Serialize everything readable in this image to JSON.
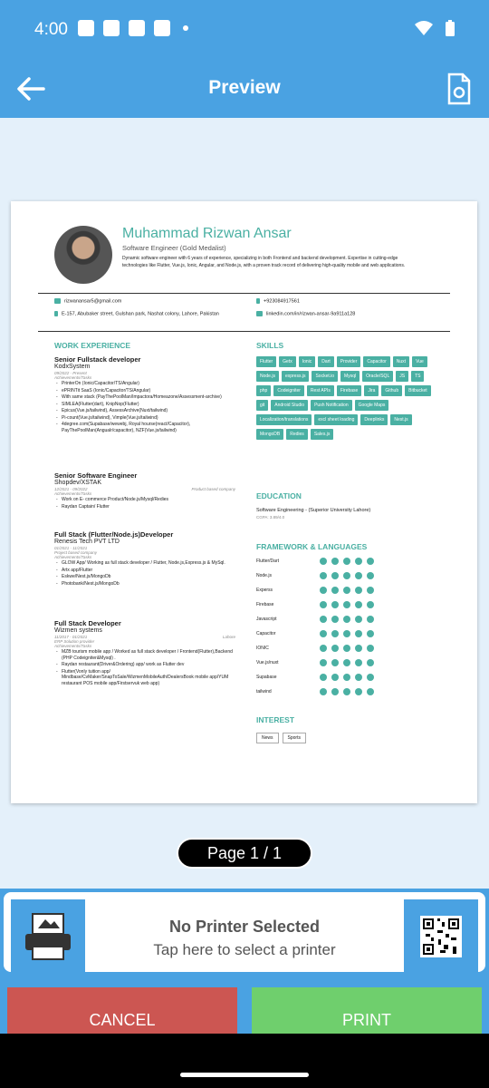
{
  "status": {
    "time": "4:00"
  },
  "appbar": {
    "title": "Preview"
  },
  "resume": {
    "name": "Muhammad Rizwan Ansar",
    "title": "Software Engineer (Gold Medalist)",
    "summary": "Dynamic software engineer with 6 years of experience, specializing in both Frontend and backend development. Expertise in cutting-edge technologies like Flutter, Vue.js, Ionic, Angular, and Node.js, with a proven track record of delivering high-quality mobile and web applications.",
    "email": "rizwanansar5@gmail.com",
    "address": "E-157, Abubaker street, Gulshan park, Nashat colony, Lahore, Pakistan",
    "phone": "+923084917561",
    "linkedin": "linkedin.com/in/rizwan-ansar-9a911a128",
    "sections": {
      "work": "WORK EXPERIENCE",
      "skills": "SKILLS",
      "education": "EDUCATION",
      "framework": "FRAMEWORK & LANGUAGES",
      "interest": "INTEREST"
    },
    "jobs": [
      {
        "title": "Senior Fullstack developer",
        "company": "KodxSystem",
        "date": "09/2022 - Present",
        "loc": "",
        "sub": "Achievements/Tasks",
        "items": [
          "PrinterOn (Ionic/Capacitor/TS/Angular)",
          "ePRINTit SaaS (Ionic/Capacitor/TS/Angular)",
          "With same stack (PayThePoolMan/Impactora/Homeazone/Assessment-archive)",
          "SIMLEA(Flutter(dart), KnipNop(Flutter)",
          "Epicus(Vue.js/tailwind), AssessArchive(Nuxt/tailwind)",
          "Pi-count(Vue.js/tailwind), Vimple(Vue.js/tailwind)",
          "4degree.com(Supabase/wewebj, Royal hourse(react/Capacitor), PayThePoolMan(Angualr/capacitor), NZF(Vue.js/tailwind)"
        ]
      },
      {
        "title": "Senior Software Engineer",
        "company": "Shopdev/XSTAK",
        "date": "12/2021 - 09/2022",
        "loc": "Product based company",
        "sub": "Achievements/Tasks",
        "items": [
          "Work on E- commerce Product/Node.js/Mysql/Redies",
          "Raydan Captain/ Flutter"
        ]
      },
      {
        "title": "Full Stack (Flutter/Node.js)Developer",
        "company": "Renesis Tech PVT LTD",
        "date": "01/2021 - 11/2021",
        "loc": "",
        "sub": "Project based company",
        "sub2": "Achievements/Tasks",
        "items": [
          "GLOW App/ Working as full stack developer / Flutter, Node.js,Express.js & MySql.",
          "Artx app/Flutter",
          "Eskwe/Nest.js/MongoDb",
          "Photobank/Nest.js/MongoDb"
        ]
      },
      {
        "title": "Full Stack Developer",
        "company": "Wizmen systems",
        "date": "11/2017 - 01/2021",
        "loc": "Lahore",
        "sub": "ERP Solution provider",
        "sub2": "Achievements/Tasks",
        "items": [
          "MZB tourism mobile app / Worked as full stack developer / Frontend(Flutter),Backend (PHP Codeigniter&Mysql) .",
          "Raydan restaurant(Driver&Ordering) app/ work as Flutter dev",
          "Flutter(Vonly tuition app/ Mindbase/CvMaker/SnapToSale/WizmenMobileAuth/DealersBook mobile app/YUM restaurant POS mobile app/Firstservuk web app)"
        ]
      }
    ],
    "skills": [
      "Flutter",
      "Getx",
      "Ionic",
      "Dart",
      "Provider",
      "Capacitor",
      "Nuxt",
      "Vue",
      "Node.js",
      "express.js",
      "Socket.io",
      "Mysql",
      "Oracle/SQL",
      "JS",
      "TS",
      "php",
      "Codeigniter",
      "Rest APIs",
      "Firebase",
      "Jira",
      "Github",
      "Bitbucket",
      "git",
      "Android Studio",
      "Push Notification",
      "Google Maps",
      "Localization/translations",
      "excl sheet loading",
      "Deeplinks",
      "Nest.js",
      "MongoDB",
      "Redies",
      "Sales.js"
    ],
    "education": "Software Engineering - (Superior University Lahore)",
    "education_sub": "CGPA: 3.89/4.0",
    "frameworks": [
      "Flutter/Dart",
      "Node.js",
      "Experss",
      "Firebase",
      "Javascript",
      "Capacitor",
      "IONIC",
      "Vue.js/nuxt",
      "Supabase",
      "tailwind"
    ],
    "interests": [
      "News",
      "Sports"
    ]
  },
  "pager": {
    "label": "Page 1 / 1"
  },
  "printer": {
    "name": "No Printer Selected",
    "hint": "Tap here to select a printer"
  },
  "buttons": {
    "cancel": "CANCEL",
    "print": "PRINT"
  },
  "colors": {
    "accent": "#4aa2e2",
    "resume_accent": "#4ab0a3",
    "cancel": "#cc5652",
    "print": "#6fcf6d"
  }
}
